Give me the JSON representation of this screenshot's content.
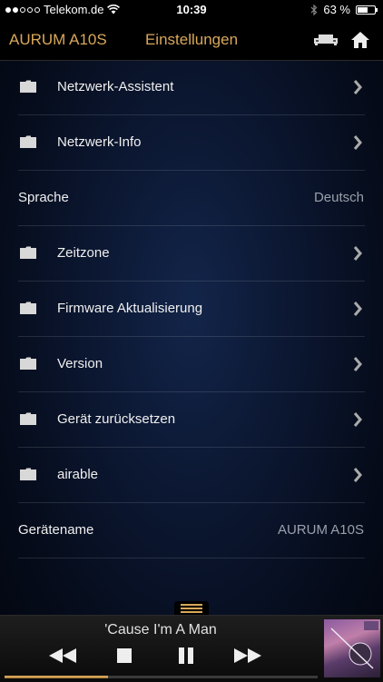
{
  "status_bar": {
    "carrier": "Telekom.de",
    "time": "10:39",
    "battery": "63 %",
    "signal_bars_filled": 2,
    "signal_bars_total": 5,
    "battery_level": 0.63
  },
  "header": {
    "brand": "AURUM A10S",
    "title": "Einstellungen",
    "accent_color": "#d8a85a"
  },
  "settings": {
    "rows": [
      {
        "label": "Netzwerk-Assistent"
      },
      {
        "label": "Netzwerk-Info"
      },
      {
        "label": "Sprache",
        "value": "Deutsch"
      },
      {
        "label": "Zeitzone"
      },
      {
        "label": "Firmware Aktualisierung"
      },
      {
        "label": "Version"
      },
      {
        "label": "Gerät zurücksetzen"
      },
      {
        "label": "airable"
      },
      {
        "label": "Gerätename",
        "value": "AURUM A10S"
      }
    ]
  },
  "player": {
    "track": "'Cause I'm A Man",
    "progress": 0.33
  }
}
